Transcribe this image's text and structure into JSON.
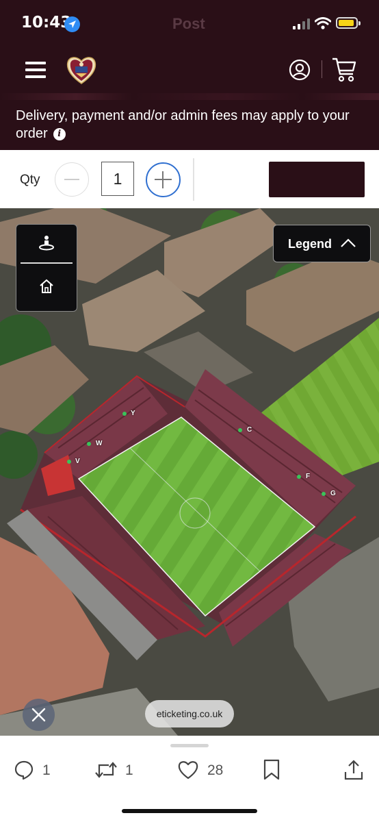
{
  "status_bar": {
    "time": "10:43",
    "ghost_title": "Post",
    "icons": [
      "location-arrow-icon",
      "signal-icon",
      "wifi-icon",
      "battery-icon"
    ]
  },
  "header": {
    "icons": [
      "menu-icon",
      "club-crest-logo",
      "account-icon",
      "cart-icon"
    ],
    "background": "#2a0f17"
  },
  "notice": {
    "text": "Delivery, payment and/or admin fees may apply to your order",
    "info_glyph": "i"
  },
  "qty": {
    "label": "Qty",
    "value": "1"
  },
  "map": {
    "legend_label": "Legend",
    "sections": [
      {
        "label": "Y"
      },
      {
        "label": "W"
      },
      {
        "label": "V"
      },
      {
        "label": "C"
      },
      {
        "label": "F"
      },
      {
        "label": "G"
      }
    ],
    "source_label": "eticketing.co.uk"
  },
  "actions": {
    "replies": "1",
    "reposts": "1",
    "likes": "28"
  },
  "colors": {
    "brand": "#2a0f17",
    "accent_blue": "#2f6fd0",
    "seat_maroon": "#7a3848",
    "pitch_green": "#6fb83e"
  }
}
